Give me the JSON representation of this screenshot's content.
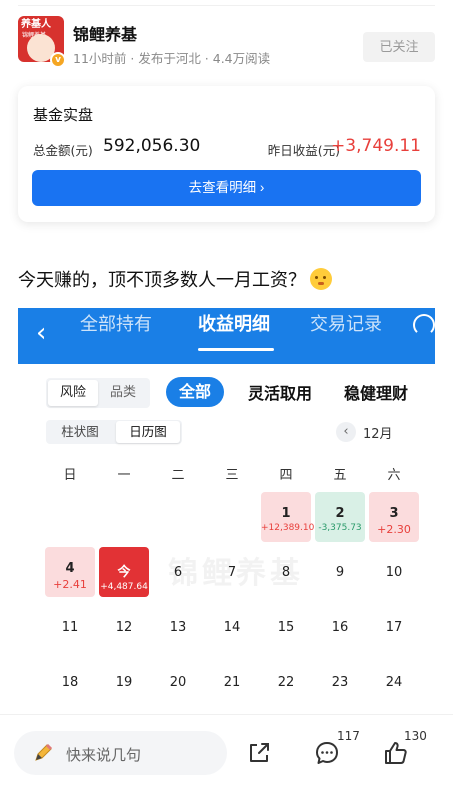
{
  "author": {
    "name": "锦鲤养基",
    "meta": "11小时前 · 发布于河北 · 4.4万阅读",
    "follow_label": "已关注",
    "avatar_text": "养基人",
    "avatar_sub": "锦鲤养基",
    "verified_mark": "v"
  },
  "fund_card": {
    "title": "基金实盘",
    "total_label": "总金额(元)",
    "total_value": "592,056.30",
    "yesterday_label": "昨日收益(元)",
    "yesterday_value": "+3,749.11",
    "detail_button": "去查看明细 ›"
  },
  "post_text": "今天赚的，顶不顶多数人一月工资？",
  "screenshot": {
    "back_icon": "‹",
    "tabs": [
      {
        "label": "全部持有",
        "active": false
      },
      {
        "label": "收益明细",
        "active": true
      },
      {
        "label": "交易记录",
        "active": false
      }
    ],
    "segment": [
      {
        "label": "风险",
        "active": true
      },
      {
        "label": "品类",
        "active": false
      }
    ],
    "filter_all": "全部",
    "filter_options": [
      "灵活取用",
      "稳健理财"
    ],
    "view_segment": [
      {
        "label": "柱状图",
        "active": false
      },
      {
        "label": "日历图",
        "active": true
      }
    ],
    "prev_icon": "‹",
    "month": "12月",
    "weekdays": [
      "日",
      "一",
      "二",
      "三",
      "四",
      "五",
      "六"
    ],
    "watermark": "锦鲤养基",
    "days": [
      {
        "d": "1",
        "v": "+12,389.10",
        "state": "pos",
        "col": 4,
        "row": 0
      },
      {
        "d": "2",
        "v": "-3,375.73",
        "state": "neg",
        "col": 5,
        "row": 0
      },
      {
        "d": "3",
        "v": "+2.30",
        "state": "pos",
        "col": 6,
        "row": 0
      },
      {
        "d": "4",
        "v": "+2.41",
        "state": "pos",
        "col": 0,
        "row": 1
      },
      {
        "d": "今",
        "v": "+4,487.64",
        "state": "today",
        "col": 1,
        "row": 1
      },
      {
        "d": "6",
        "v": "",
        "state": "plain",
        "col": 2,
        "row": 1
      },
      {
        "d": "7",
        "v": "",
        "state": "plain",
        "col": 3,
        "row": 1
      },
      {
        "d": "8",
        "v": "",
        "state": "plain",
        "col": 4,
        "row": 1
      },
      {
        "d": "9",
        "v": "",
        "state": "plain",
        "col": 5,
        "row": 1
      },
      {
        "d": "10",
        "v": "",
        "state": "plain",
        "col": 6,
        "row": 1
      },
      {
        "d": "11",
        "v": "",
        "state": "plain",
        "col": 0,
        "row": 2
      },
      {
        "d": "12",
        "v": "",
        "state": "plain",
        "col": 1,
        "row": 2
      },
      {
        "d": "13",
        "v": "",
        "state": "plain",
        "col": 2,
        "row": 2
      },
      {
        "d": "14",
        "v": "",
        "state": "plain",
        "col": 3,
        "row": 2
      },
      {
        "d": "15",
        "v": "",
        "state": "plain",
        "col": 4,
        "row": 2
      },
      {
        "d": "16",
        "v": "",
        "state": "plain",
        "col": 5,
        "row": 2
      },
      {
        "d": "17",
        "v": "",
        "state": "plain",
        "col": 6,
        "row": 2
      },
      {
        "d": "18",
        "v": "",
        "state": "plain",
        "col": 0,
        "row": 3
      },
      {
        "d": "19",
        "v": "",
        "state": "plain",
        "col": 1,
        "row": 3
      },
      {
        "d": "20",
        "v": "",
        "state": "plain",
        "col": 2,
        "row": 3
      },
      {
        "d": "21",
        "v": "",
        "state": "plain",
        "col": 3,
        "row": 3
      },
      {
        "d": "22",
        "v": "",
        "state": "plain",
        "col": 4,
        "row": 3
      },
      {
        "d": "23",
        "v": "",
        "state": "plain",
        "col": 5,
        "row": 3
      },
      {
        "d": "24",
        "v": "",
        "state": "plain",
        "col": 6,
        "row": 3
      }
    ]
  },
  "bottom_bar": {
    "comment_placeholder": "快来说几句",
    "comment_count": "117",
    "like_count": "130"
  },
  "colors": {
    "accent_blue": "#1973f2",
    "profit_red": "#e8403c",
    "loss_green": "#2b9a6a"
  },
  "icons": [
    "pencil-icon",
    "share-icon",
    "comment-icon",
    "like-icon",
    "back-icon",
    "service-icon",
    "verified-icon"
  ]
}
